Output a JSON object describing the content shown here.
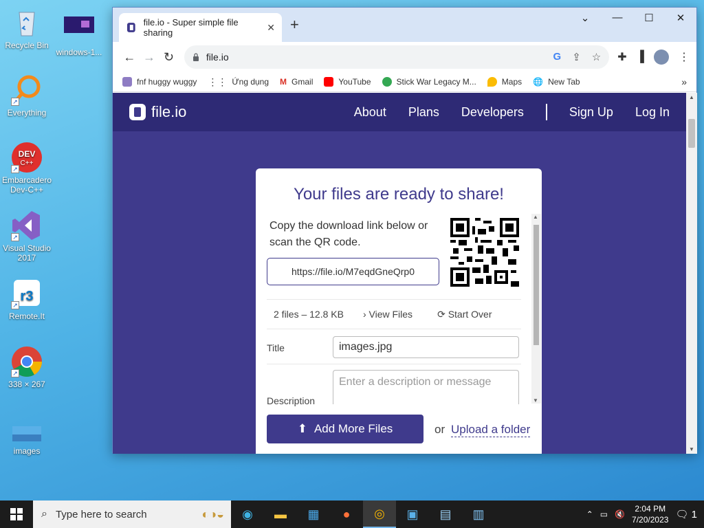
{
  "desktop": {
    "icons": [
      {
        "label": "Recycle Bin",
        "icon": "recycle-bin-icon"
      },
      {
        "label": "windows-1...",
        "icon": "image-file-icon"
      },
      {
        "label": "Everything",
        "icon": "everything-search-icon"
      },
      {
        "label": "Embarcadero Dev-C++",
        "icon": "devcpp-icon"
      },
      {
        "label": "Visual Studio 2017",
        "icon": "visual-studio-icon"
      },
      {
        "label": "Remote.It",
        "icon": "remoteit-icon"
      },
      {
        "label": "338 × 267",
        "icon": "chrome-icon"
      },
      {
        "label": "images",
        "icon": "image-file-icon"
      }
    ]
  },
  "browser": {
    "tab_title": "file.io - Super simple file sharing",
    "url": "file.io",
    "bookmarks": [
      {
        "label": "fnf huggy wuggy",
        "color": "#8e7cc3"
      },
      {
        "label": "Ứng dụng",
        "color": "#5f6368"
      },
      {
        "label": "Gmail",
        "color": "#d93025"
      },
      {
        "label": "YouTube",
        "color": "#ff0000"
      },
      {
        "label": "Stick War Legacy M...",
        "color": "#34a853"
      },
      {
        "label": "Maps",
        "color": "#fbbc04"
      },
      {
        "label": "New Tab",
        "color": "#333333"
      }
    ]
  },
  "site": {
    "logo_text": "file.io",
    "nav": [
      "About",
      "Plans",
      "Developers",
      "Sign Up",
      "Log In"
    ],
    "card": {
      "heading": "Your files are ready to share!",
      "copy_text": "Copy the download link below or scan the QR code.",
      "link": "https://file.io/M7eqdGneQrp0",
      "file_summary": "2 files – 12.8 KB",
      "view_files": "View Files",
      "start_over": "Start Over",
      "title_label": "Title",
      "title_value": "images.jpg",
      "description_label": "Description",
      "description_placeholder": "Enter a description or message",
      "add_more": "Add More Files",
      "or_text": "or",
      "upload_folder": "Upload a folder"
    },
    "accent": "#3f3a8c"
  },
  "taskbar": {
    "search_placeholder": "Type here to search",
    "time": "2:04 PM",
    "date": "7/20/2023",
    "notification_count": "1"
  }
}
